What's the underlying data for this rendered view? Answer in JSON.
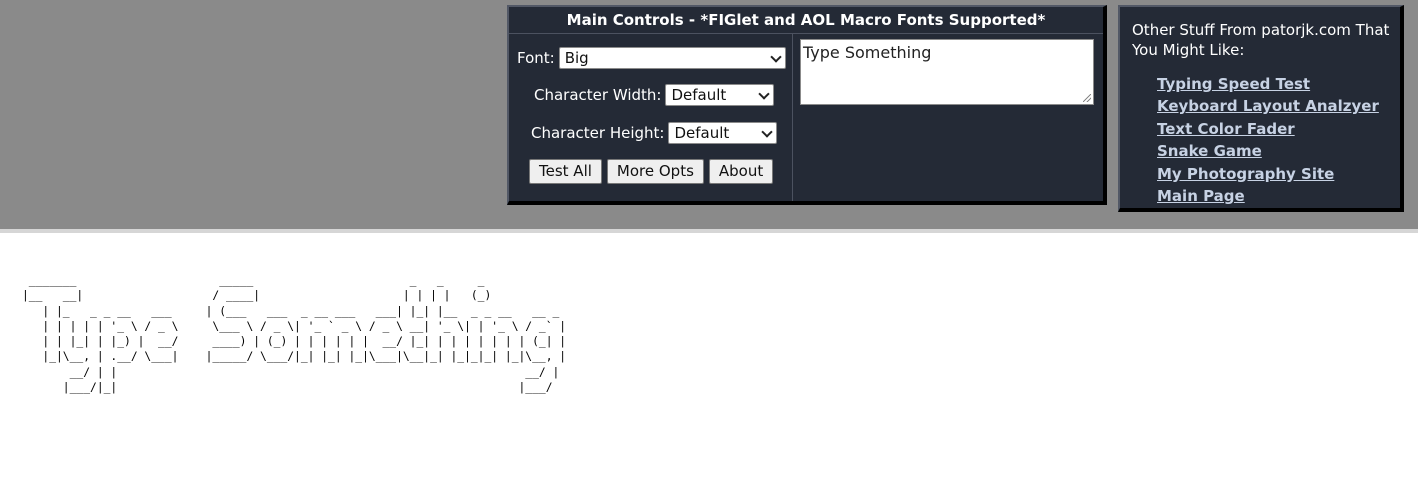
{
  "main_controls": {
    "title": "Main Controls - *FIGlet and AOL Macro Fonts Supported*",
    "font_label": "Font:",
    "font_value": "Big",
    "char_width_label": "Character Width:",
    "char_width_value": "Default",
    "char_height_label": "Character Height:",
    "char_height_value": "Default",
    "buttons": {
      "test_all": "Test All",
      "more_opts": "More Opts",
      "about": "About"
    },
    "input_text": "Type Something"
  },
  "sidebar": {
    "heading": "Other Stuff From patorjk.com That You Might Like:",
    "links": [
      "Typing Speed Test",
      "Keyboard Layout Analzyer",
      "Text Color Fader",
      "Snake Game",
      "My Photography Site",
      "Main Page"
    ]
  },
  "output": {
    "ascii_art": " _______                     _____                       _   _     _             \n|__   __|                   / ____|                     | | | |   (_)            \n   | |_   _ _ __   ___     | (___   ___  _ __ ___   ___| |_| |__  _ _ __   __ _ \n   | | | | | '_ \\ / _ \\     \\___ \\ / _ \\| '_ ` _ \\ / _ \\ __| '_ \\| | '_ \\ / _` |\n   | | |_| | |_) |  __/     ____) | (_) | | | | | |  __/ |_| | | | | | | | (_| |\n   |_|\\__, | .__/ \\___|    |_____/ \\___/|_| |_| |_|\\___|\\__|_| |_|_|_| |_|\\__, |\n       __/ | |                                                            __/ |\n      |___/|_|                                                           |___/ "
  },
  "colors": {
    "panel_bg": "#242a36",
    "top_band": "#8a8a8a",
    "link": "#c7d2e4"
  }
}
